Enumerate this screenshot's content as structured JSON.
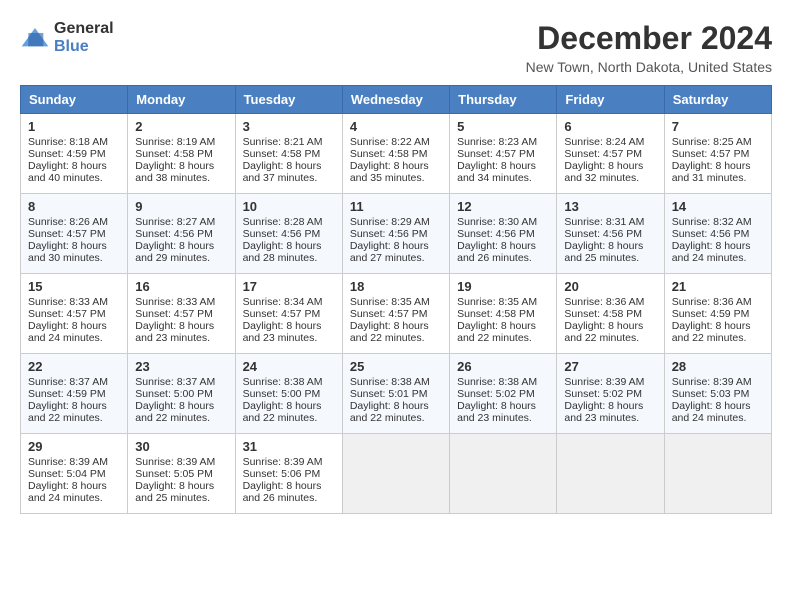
{
  "header": {
    "logo_general": "General",
    "logo_blue": "Blue",
    "title": "December 2024",
    "subtitle": "New Town, North Dakota, United States"
  },
  "columns": [
    "Sunday",
    "Monday",
    "Tuesday",
    "Wednesday",
    "Thursday",
    "Friday",
    "Saturday"
  ],
  "weeks": [
    [
      {
        "day": "1",
        "sunrise": "Sunrise: 8:18 AM",
        "sunset": "Sunset: 4:59 PM",
        "daylight": "Daylight: 8 hours and 40 minutes."
      },
      {
        "day": "2",
        "sunrise": "Sunrise: 8:19 AM",
        "sunset": "Sunset: 4:58 PM",
        "daylight": "Daylight: 8 hours and 38 minutes."
      },
      {
        "day": "3",
        "sunrise": "Sunrise: 8:21 AM",
        "sunset": "Sunset: 4:58 PM",
        "daylight": "Daylight: 8 hours and 37 minutes."
      },
      {
        "day": "4",
        "sunrise": "Sunrise: 8:22 AM",
        "sunset": "Sunset: 4:58 PM",
        "daylight": "Daylight: 8 hours and 35 minutes."
      },
      {
        "day": "5",
        "sunrise": "Sunrise: 8:23 AM",
        "sunset": "Sunset: 4:57 PM",
        "daylight": "Daylight: 8 hours and 34 minutes."
      },
      {
        "day": "6",
        "sunrise": "Sunrise: 8:24 AM",
        "sunset": "Sunset: 4:57 PM",
        "daylight": "Daylight: 8 hours and 32 minutes."
      },
      {
        "day": "7",
        "sunrise": "Sunrise: 8:25 AM",
        "sunset": "Sunset: 4:57 PM",
        "daylight": "Daylight: 8 hours and 31 minutes."
      }
    ],
    [
      {
        "day": "8",
        "sunrise": "Sunrise: 8:26 AM",
        "sunset": "Sunset: 4:57 PM",
        "daylight": "Daylight: 8 hours and 30 minutes."
      },
      {
        "day": "9",
        "sunrise": "Sunrise: 8:27 AM",
        "sunset": "Sunset: 4:56 PM",
        "daylight": "Daylight: 8 hours and 29 minutes."
      },
      {
        "day": "10",
        "sunrise": "Sunrise: 8:28 AM",
        "sunset": "Sunset: 4:56 PM",
        "daylight": "Daylight: 8 hours and 28 minutes."
      },
      {
        "day": "11",
        "sunrise": "Sunrise: 8:29 AM",
        "sunset": "Sunset: 4:56 PM",
        "daylight": "Daylight: 8 hours and 27 minutes."
      },
      {
        "day": "12",
        "sunrise": "Sunrise: 8:30 AM",
        "sunset": "Sunset: 4:56 PM",
        "daylight": "Daylight: 8 hours and 26 minutes."
      },
      {
        "day": "13",
        "sunrise": "Sunrise: 8:31 AM",
        "sunset": "Sunset: 4:56 PM",
        "daylight": "Daylight: 8 hours and 25 minutes."
      },
      {
        "day": "14",
        "sunrise": "Sunrise: 8:32 AM",
        "sunset": "Sunset: 4:56 PM",
        "daylight": "Daylight: 8 hours and 24 minutes."
      }
    ],
    [
      {
        "day": "15",
        "sunrise": "Sunrise: 8:33 AM",
        "sunset": "Sunset: 4:57 PM",
        "daylight": "Daylight: 8 hours and 24 minutes."
      },
      {
        "day": "16",
        "sunrise": "Sunrise: 8:33 AM",
        "sunset": "Sunset: 4:57 PM",
        "daylight": "Daylight: 8 hours and 23 minutes."
      },
      {
        "day": "17",
        "sunrise": "Sunrise: 8:34 AM",
        "sunset": "Sunset: 4:57 PM",
        "daylight": "Daylight: 8 hours and 23 minutes."
      },
      {
        "day": "18",
        "sunrise": "Sunrise: 8:35 AM",
        "sunset": "Sunset: 4:57 PM",
        "daylight": "Daylight: 8 hours and 22 minutes."
      },
      {
        "day": "19",
        "sunrise": "Sunrise: 8:35 AM",
        "sunset": "Sunset: 4:58 PM",
        "daylight": "Daylight: 8 hours and 22 minutes."
      },
      {
        "day": "20",
        "sunrise": "Sunrise: 8:36 AM",
        "sunset": "Sunset: 4:58 PM",
        "daylight": "Daylight: 8 hours and 22 minutes."
      },
      {
        "day": "21",
        "sunrise": "Sunrise: 8:36 AM",
        "sunset": "Sunset: 4:59 PM",
        "daylight": "Daylight: 8 hours and 22 minutes."
      }
    ],
    [
      {
        "day": "22",
        "sunrise": "Sunrise: 8:37 AM",
        "sunset": "Sunset: 4:59 PM",
        "daylight": "Daylight: 8 hours and 22 minutes."
      },
      {
        "day": "23",
        "sunrise": "Sunrise: 8:37 AM",
        "sunset": "Sunset: 5:00 PM",
        "daylight": "Daylight: 8 hours and 22 minutes."
      },
      {
        "day": "24",
        "sunrise": "Sunrise: 8:38 AM",
        "sunset": "Sunset: 5:00 PM",
        "daylight": "Daylight: 8 hours and 22 minutes."
      },
      {
        "day": "25",
        "sunrise": "Sunrise: 8:38 AM",
        "sunset": "Sunset: 5:01 PM",
        "daylight": "Daylight: 8 hours and 22 minutes."
      },
      {
        "day": "26",
        "sunrise": "Sunrise: 8:38 AM",
        "sunset": "Sunset: 5:02 PM",
        "daylight": "Daylight: 8 hours and 23 minutes."
      },
      {
        "day": "27",
        "sunrise": "Sunrise: 8:39 AM",
        "sunset": "Sunset: 5:02 PM",
        "daylight": "Daylight: 8 hours and 23 minutes."
      },
      {
        "day": "28",
        "sunrise": "Sunrise: 8:39 AM",
        "sunset": "Sunset: 5:03 PM",
        "daylight": "Daylight: 8 hours and 24 minutes."
      }
    ],
    [
      {
        "day": "29",
        "sunrise": "Sunrise: 8:39 AM",
        "sunset": "Sunset: 5:04 PM",
        "daylight": "Daylight: 8 hours and 24 minutes."
      },
      {
        "day": "30",
        "sunrise": "Sunrise: 8:39 AM",
        "sunset": "Sunset: 5:05 PM",
        "daylight": "Daylight: 8 hours and 25 minutes."
      },
      {
        "day": "31",
        "sunrise": "Sunrise: 8:39 AM",
        "sunset": "Sunset: 5:06 PM",
        "daylight": "Daylight: 8 hours and 26 minutes."
      },
      null,
      null,
      null,
      null
    ]
  ]
}
